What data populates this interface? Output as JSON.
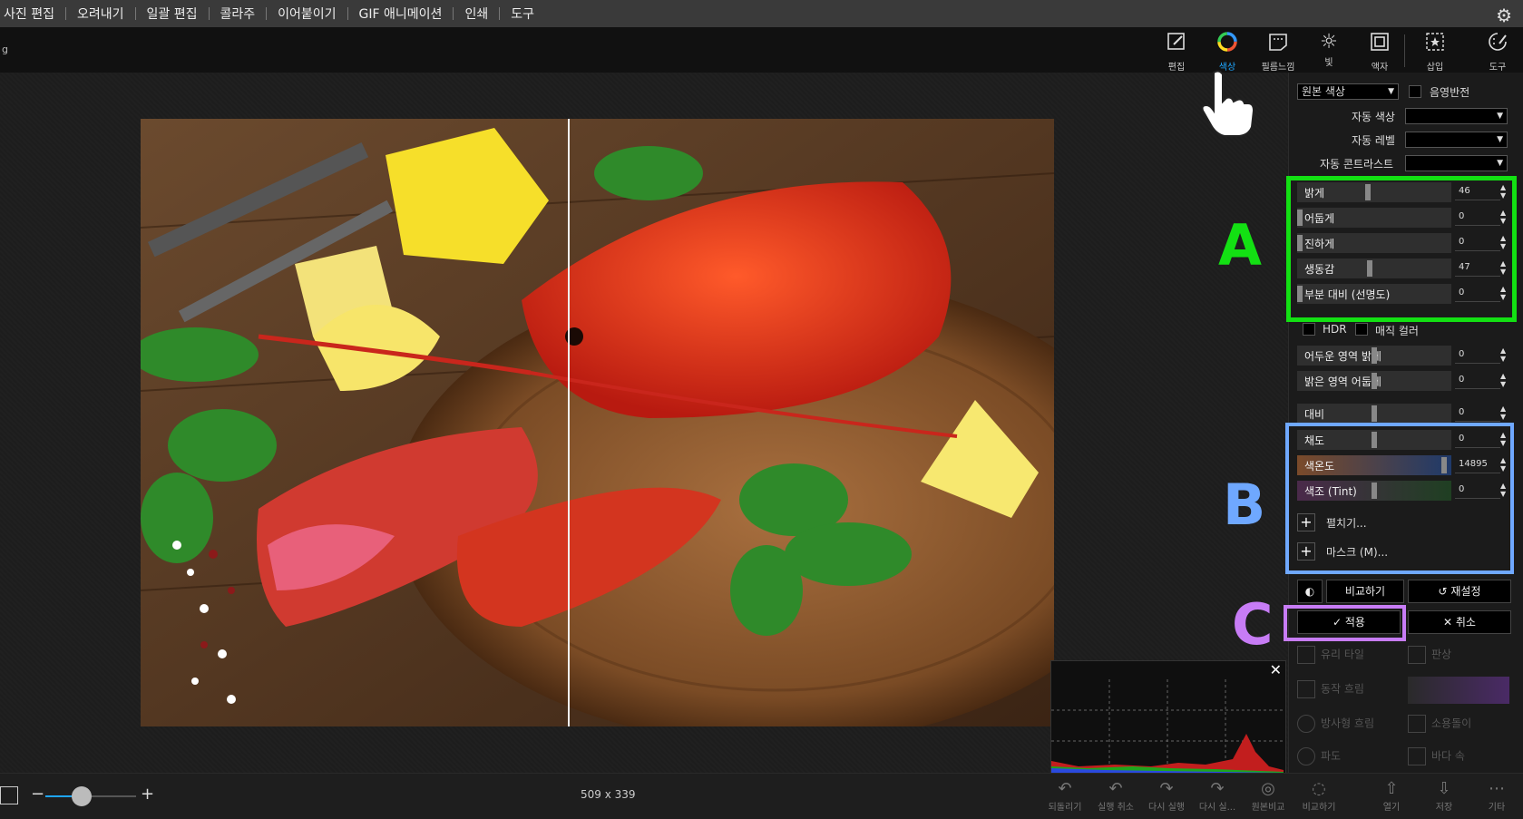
{
  "menubar": {
    "items": [
      "사진 편집",
      "오려내기",
      "일괄 편집",
      "콜라주",
      "이어붙이기",
      "GIF 애니메이션",
      "인쇄",
      "도구"
    ]
  },
  "toolbar": {
    "left_text": "g",
    "tools": [
      {
        "label": "편집",
        "icon": "edit-icon"
      },
      {
        "label": "색상",
        "icon": "color-wheel-icon",
        "active": true
      },
      {
        "label": "필름느낌",
        "icon": "film-icon"
      },
      {
        "label": "빛",
        "icon": "light-icon"
      },
      {
        "label": "액자",
        "icon": "frame-icon"
      },
      {
        "label": "삽입",
        "icon": "insert-icon"
      },
      {
        "label": "도구",
        "icon": "tools-icon"
      }
    ]
  },
  "panel": {
    "color_mode": "원본 색상",
    "invert_label": "음영반전",
    "auto_color_label": "자동 색상",
    "auto_level_label": "자동 레벨",
    "auto_contrast_label": "자동 콘트라스트",
    "sliders_a": [
      {
        "name": "밝게",
        "value": "46",
        "level": 0.46
      },
      {
        "name": "어둡게",
        "value": "0",
        "level": 0
      },
      {
        "name": "진하게",
        "value": "0",
        "level": 0
      },
      {
        "name": "생동감",
        "value": "47",
        "level": 0.47
      },
      {
        "name": "부분 대비 (선명도)",
        "value": "0",
        "level": 0
      }
    ],
    "hdr_label": "HDR",
    "magic_label": "매직 컬러",
    "sliders_mid": [
      {
        "name": "어두운 영역 밝게",
        "value": "0",
        "level": 0.5
      },
      {
        "name": "밝은 영역 어둡게",
        "value": "0",
        "level": 0.5
      }
    ],
    "contrast": {
      "name": "대비",
      "value": "0",
      "level": 0.5
    },
    "sliders_b": [
      {
        "name": "채도",
        "value": "0",
        "level": 0.5
      },
      {
        "name": "색온도",
        "value": "14895",
        "level": 0.97
      },
      {
        "name": "색조 (Tint)",
        "value": "0",
        "level": 0.5
      }
    ],
    "expand_label": "펼치기...",
    "mask_label": "마스크 (M)...",
    "compare_label": "비교하기",
    "reset_label": "재설정",
    "apply_label": "적용",
    "cancel_label": "취소",
    "effects": [
      "유리 타일",
      "판상",
      "동작 흐림",
      "",
      "방사형 흐림",
      "소용돌이",
      "파도",
      "바다 속"
    ]
  },
  "annotations": {
    "a": "A",
    "b": "B",
    "c": "C",
    "a_color": "#13e013",
    "b_color": "#6fa8ff",
    "c_color": "#c77cf5"
  },
  "canvas": {
    "dimensions": "509 x 339"
  },
  "bottombar": {
    "zoom_level": 0.4,
    "actions": [
      {
        "label": "되돌리기",
        "icon": "undo-all-icon"
      },
      {
        "label": "실행 취소",
        "icon": "undo-icon"
      },
      {
        "label": "다시 실행",
        "icon": "redo-icon"
      },
      {
        "label": "다시 실...",
        "icon": "redo-all-icon"
      },
      {
        "label": "원본비교",
        "icon": "compare-original-icon"
      },
      {
        "label": "비교하기",
        "icon": "compare-icon"
      },
      {
        "label": "열기",
        "icon": "open-icon"
      },
      {
        "label": "저장",
        "icon": "save-icon"
      },
      {
        "label": "기타",
        "icon": "more-icon"
      }
    ]
  },
  "colors": {
    "accent": "#1ea6ff"
  }
}
